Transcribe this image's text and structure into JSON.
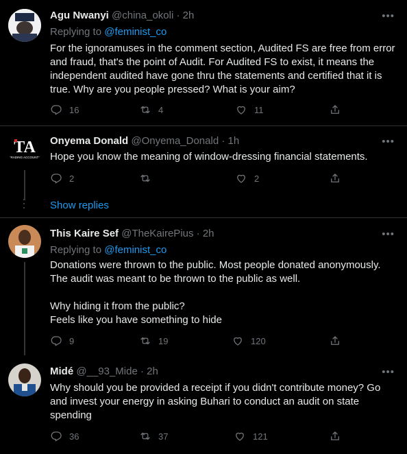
{
  "tweets": [
    {
      "name": "Agu Nwanyi",
      "handle": "@china_okoli",
      "time": "· 2h",
      "replying_prefix": "Replying to ",
      "replying_to": "@feminist_co",
      "text": "For the ignoramuses in the comment section, Audited FS are free from error and fraud, that's the point of Audit. For Audited FS to exist, it means the independent audited have gone thru the statements and certified that it is true. Why are you people pressed? What is your aim?",
      "replies": "16",
      "retweets": "4",
      "likes": "11"
    },
    {
      "name": "Onyema Donald",
      "handle": "@Onyema_Donald",
      "time": "· 1h",
      "text": "Hope you know the meaning of window-dressing financial statements.",
      "replies": "2",
      "retweets": "",
      "likes": "2",
      "avatar_letters": "TA",
      "avatar_caption": "TRADING ACCOUNTS"
    },
    {
      "name": "This Kaire Sef",
      "handle": "@TheKairePius",
      "time": "· 2h",
      "replying_prefix": "Replying to ",
      "replying_to": "@feminist_co",
      "text": "Donations were thrown to the public. Most people donated anonymously. The audit was meant to be thrown to the public as well.\n\nWhy hiding it from the public?\nFeels like you have something to hide",
      "replies": "9",
      "retweets": "19",
      "likes": "120"
    },
    {
      "name": "Midé",
      "handle": "@__93_Mide",
      "time": "· 2h",
      "text": "Why should you be provided a receipt if you didn't contribute money? Go and invest your energy in asking Buhari to conduct an audit on state spending",
      "replies": "36",
      "retweets": "37",
      "likes": "121"
    }
  ],
  "show_replies": "Show replies",
  "more_glyph": "•••",
  "icons": {
    "reply": "reply-icon",
    "retweet": "retweet-icon",
    "like": "heart-icon",
    "share": "share-icon"
  },
  "colors": {
    "background": "#000000",
    "accent": "#1d9bf0",
    "muted": "#71767b",
    "text": "#e7e9ea"
  }
}
